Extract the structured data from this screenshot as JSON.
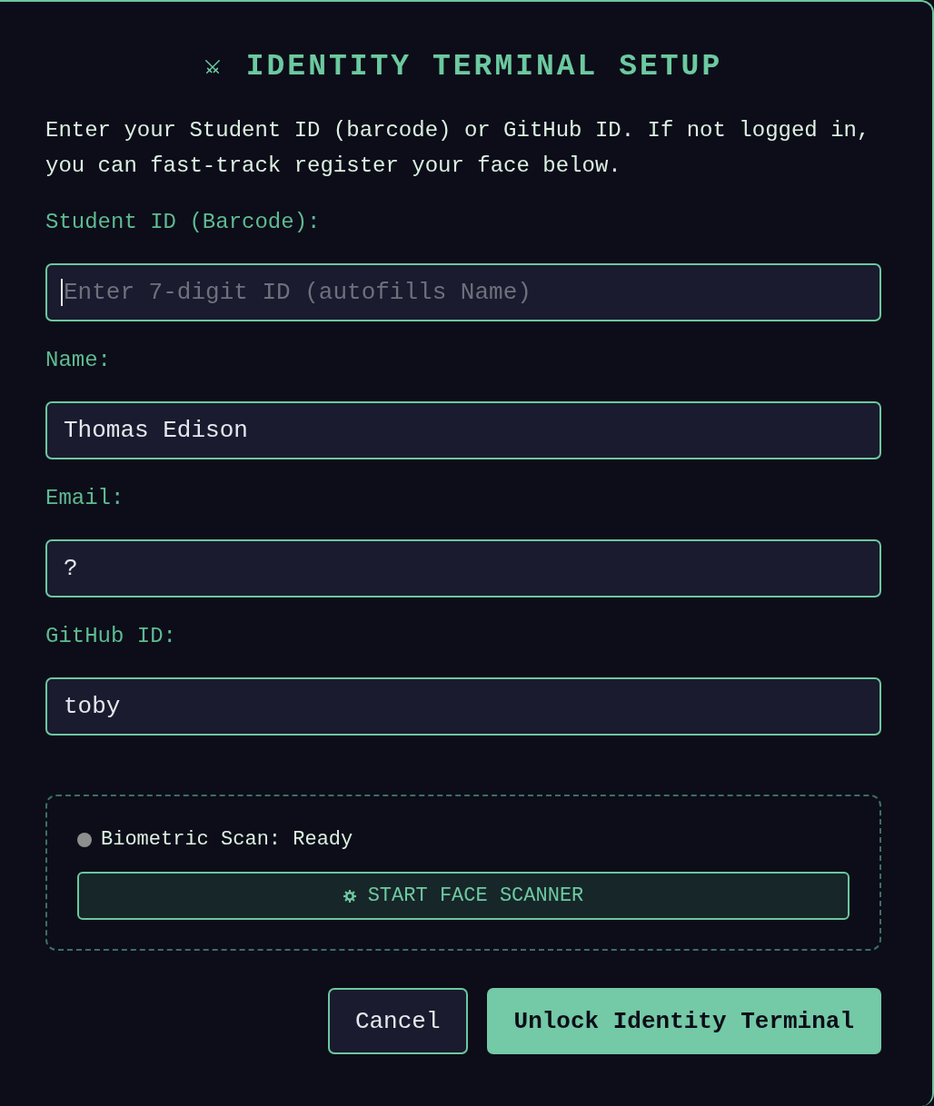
{
  "dialog": {
    "title": "IDENTITY TERMINAL SETUP",
    "description": "Enter your Student ID (barcode) or GitHub ID. If not logged in, you can fast-track register your face below."
  },
  "fields": [
    {
      "label": "Student ID (Barcode):",
      "placeholder": "Enter 7-digit ID (autofills Name)",
      "focused": true
    },
    {
      "label": "Name:",
      "value": "Thomas Edison",
      "focused": false
    },
    {
      "label": "Email:",
      "value": "?",
      "focused": false
    },
    {
      "label": "GitHub ID:",
      "value": "toby",
      "focused": false
    }
  ],
  "biometric": {
    "status": "Biometric Scan: Ready",
    "color": "#8e8e8e",
    "scan_button": "START FACE SCANNER"
  },
  "buttons": [
    {
      "label": "Cancel",
      "kind": "secondary"
    },
    {
      "label": "Unlock Identity Terminal",
      "kind": "primary"
    }
  ]
}
